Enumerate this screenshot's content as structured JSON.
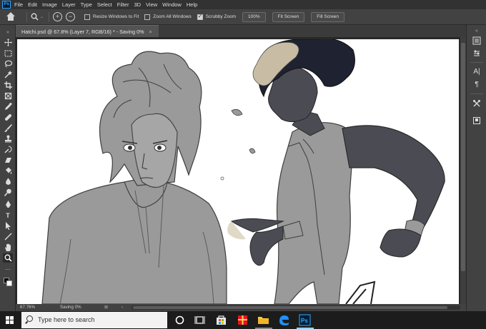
{
  "app": {
    "logo_text": "Ps",
    "menu": [
      "File",
      "Edit",
      "Image",
      "Layer",
      "Type",
      "Select",
      "Filter",
      "3D",
      "View",
      "Window",
      "Help"
    ]
  },
  "options_bar": {
    "resize_windows_label": "Resize Windows to Fit",
    "resize_windows_checked": false,
    "zoom_all_label": "Zoom All Windows",
    "zoom_all_checked": false,
    "scrubby_zoom_label": "Scrubby Zoom",
    "scrubby_zoom_checked": true,
    "btn_100": "100%",
    "btn_fit": "Fit Screen",
    "btn_fill": "Fill Screen"
  },
  "document": {
    "tab_title": "Hatchi.psd @ 67.8% (Layer 7, RGB/16) * - Saving 0%",
    "close_glyph": "×"
  },
  "status": {
    "zoom": "67.76%",
    "saving": "Saving 0%"
  },
  "taskbar": {
    "search_placeholder": "Type here to search",
    "pinned": [
      "task-view",
      "file-explorer",
      "microsoft-store",
      "gift-app",
      "folder",
      "edge",
      "photoshop"
    ]
  },
  "colors": {
    "ps_blue": "#31a8ff",
    "panel": "#424242",
    "menubar": "#323232",
    "taskbar": "#1c1c1c"
  }
}
